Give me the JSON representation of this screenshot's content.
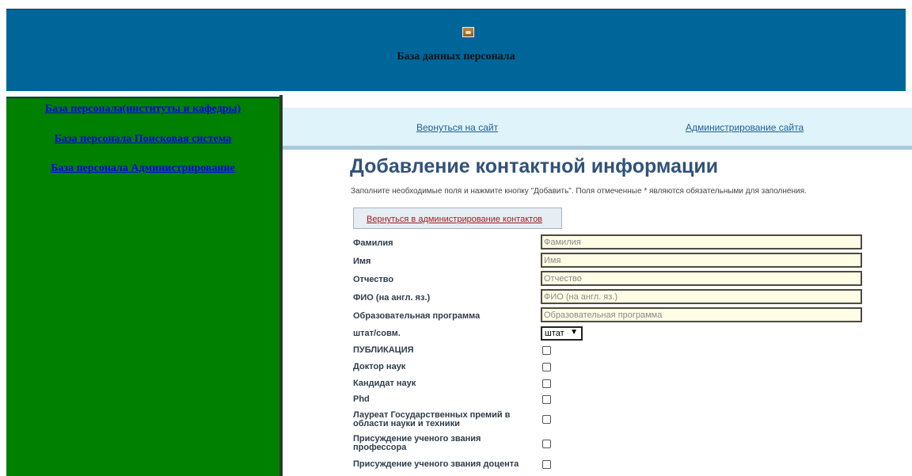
{
  "header": {
    "title": "База данных персонала",
    "logo_icon": "site-logo-image"
  },
  "sidebar": {
    "links": [
      "База персонала(институты и кафедры)",
      "База персонала Поисковая система",
      "База персонала Администрирование"
    ]
  },
  "topnav": {
    "back_to_site": "Вернуться на сайт",
    "site_admin": "Администрирование сайта"
  },
  "page": {
    "heading": "Добавление контактной информации",
    "instructions": "Заполните необходимые поля и нажмите кнопку \"Добавить\". Поля отмеченные * являются обязательными для заполнения.",
    "back_link": "Вернуться в администрирование контактов"
  },
  "form": {
    "last_name": {
      "label": "Фамилия",
      "placeholder": "Фамилия"
    },
    "first_name": {
      "label": "Имя",
      "placeholder": "Имя"
    },
    "patronymic": {
      "label": "Отчество",
      "placeholder": "Отчество"
    },
    "name_en": {
      "label": "ФИО (на англ. яз.)",
      "placeholder": "ФИО (на англ. яз.)"
    },
    "edu_program": {
      "label": "Образовательная программа",
      "placeholder": "Образовательная программа"
    },
    "employment": {
      "label": "штат/совм.",
      "value": "штат"
    },
    "publication": {
      "label": "ПУБЛИКАЦИЯ"
    },
    "doctor": {
      "label": "Доктор наук"
    },
    "candidate": {
      "label": "Кандидат наук"
    },
    "phd": {
      "label": "Phd"
    },
    "laureate": {
      "label_line1": "Лауреат Государственных премий в",
      "label_line2": "области науки и техники"
    },
    "professor": {
      "label_line1": "Присуждение ученого звания",
      "label_line2": "профессора"
    },
    "docent": {
      "label": "Присуждение ученого звания доцента"
    }
  },
  "colors": {
    "header": "#006699",
    "sidebar": "#008000",
    "heading": "#31527a",
    "input_bg": "#fffde5"
  }
}
